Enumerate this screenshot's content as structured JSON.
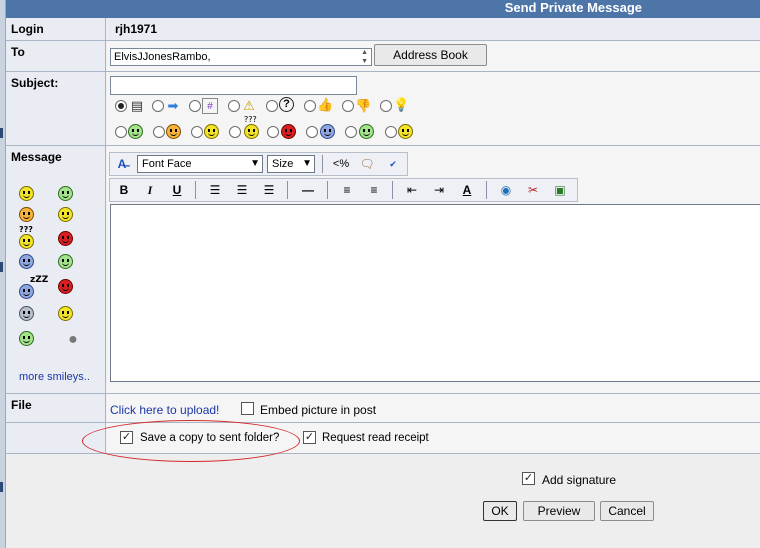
{
  "title": "Send Private Message",
  "login": {
    "label": "Login",
    "value": "rjh1971"
  },
  "to": {
    "label": "To",
    "value": "ElvisJJonesRambo,",
    "address_book_label": "Address Book"
  },
  "subject": {
    "label": "Subject:",
    "value": ""
  },
  "message": {
    "label": "Message",
    "more_smileys_label": "more smileys..",
    "font_face_label": "Font Face",
    "size_label": "Size",
    "percent_label": "<%",
    "body": ""
  },
  "file": {
    "label": "File",
    "upload_link": "Click here to upload!",
    "embed_label": "Embed picture in post",
    "embed_checked": false
  },
  "options": {
    "save_copy_label": "Save a copy to sent folder?",
    "save_copy_checked": true,
    "read_receipt_label": "Request read receipt",
    "read_receipt_checked": true,
    "add_signature_label": "Add signature",
    "add_signature_checked": true
  },
  "buttons": {
    "ok": "OK",
    "preview": "Preview",
    "cancel": "Cancel"
  },
  "colors": {
    "titlebar": "#4e75a8",
    "annotation_oval": "#d3292b",
    "link": "#1a37a8"
  }
}
